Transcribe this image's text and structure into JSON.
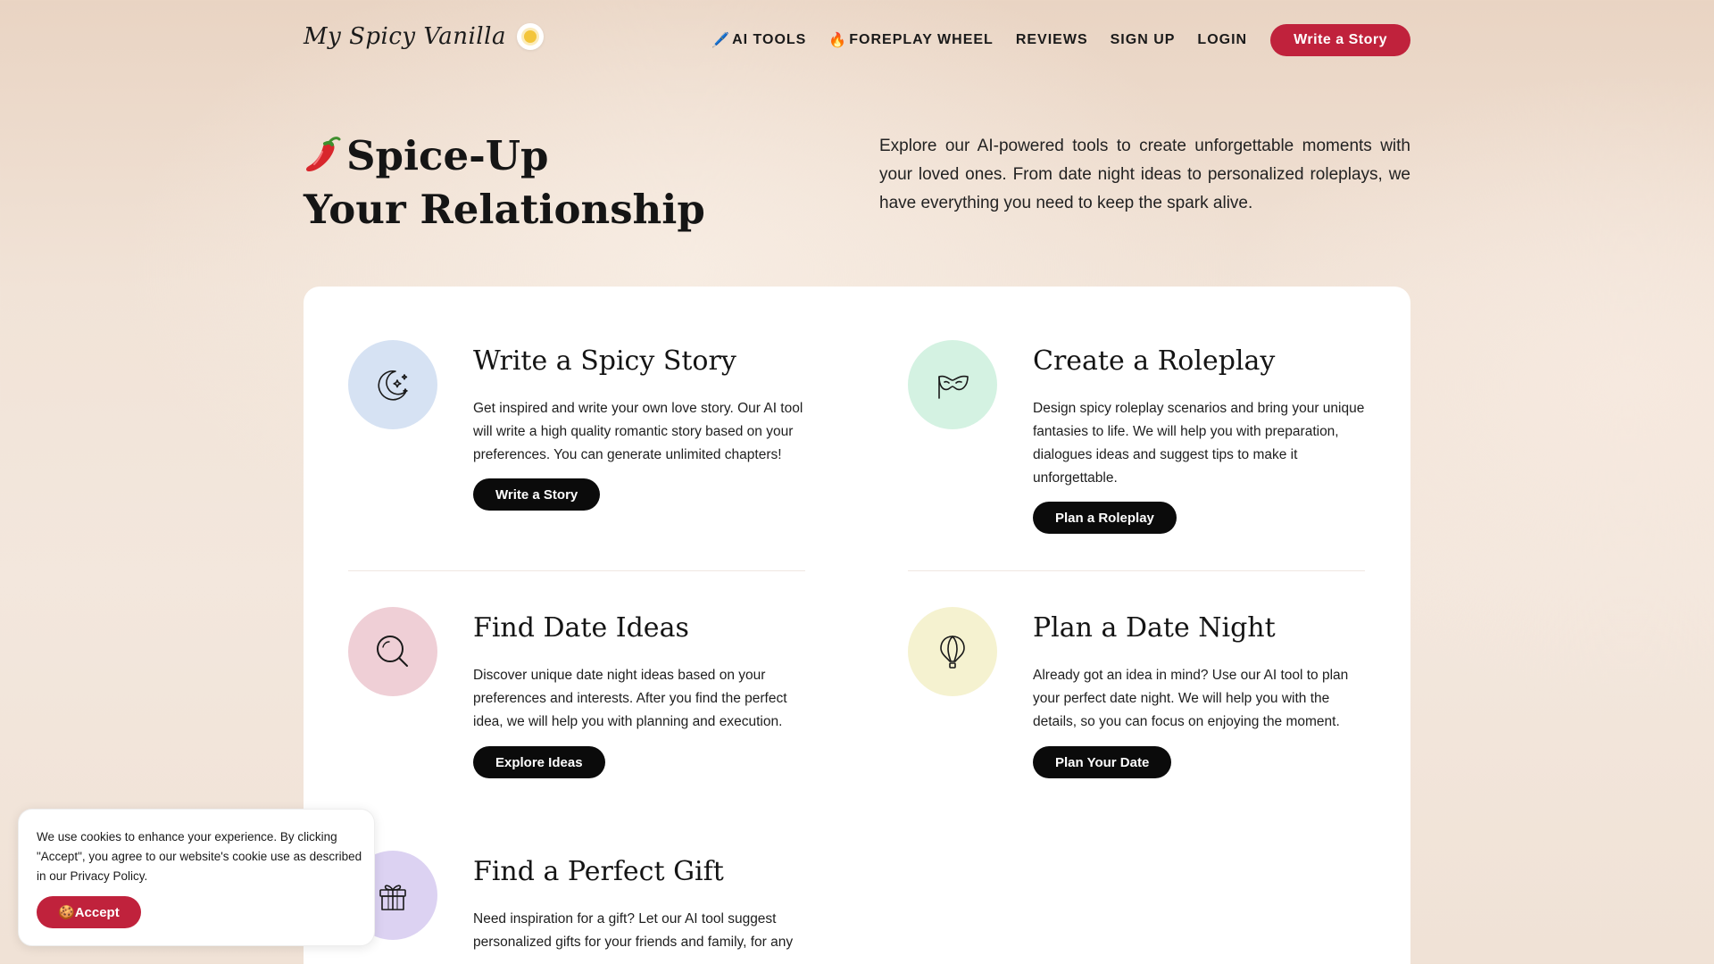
{
  "nav": {
    "logo_text": "My Spicy Vanilla",
    "links": [
      {
        "emoji": "🖊️",
        "label": "AI TOOLS"
      },
      {
        "emoji": "🔥",
        "label": "FOREPLAY WHEEL"
      },
      {
        "emoji": "",
        "label": "REVIEWS"
      },
      {
        "emoji": "",
        "label": "SIGN UP"
      },
      {
        "emoji": "",
        "label": "LOGIN"
      }
    ],
    "cta": "Write a Story"
  },
  "hero": {
    "title_line1": "Spice-Up",
    "title_line2": "Your Relationship",
    "description": "Explore our AI-powered tools to create unforgettable moments with your loved ones. From date night ideas to personalized roleplays, we have everything you need to keep the spark alive."
  },
  "features": [
    {
      "title": "Write a Spicy Story",
      "description": "Get inspired and write your own love story. Our AI tool will write a high quality romantic story based on your preferences. You can generate unlimited chapters!",
      "button": "Write a Story",
      "icon": "moon-stars-icon",
      "icon_bg": "#d6e2f3"
    },
    {
      "title": "Create a Roleplay",
      "description": "Design spicy roleplay scenarios and bring your unique fantasies to life. We will help you with preparation, dialogues ideas and suggest tips to make it unforgettable.",
      "button": "Plan a Roleplay",
      "icon": "mask-icon",
      "icon_bg": "#d4f2e2"
    },
    {
      "title": "Find Date Ideas",
      "description": "Discover unique date night ideas based on your preferences and interests. After you find the perfect idea, we will help you with planning and execution.",
      "button": "Explore Ideas",
      "icon": "search-icon",
      "icon_bg": "#efcfd6"
    },
    {
      "title": "Plan a Date Night",
      "description": "Already got an idea in mind? Use our AI tool to plan your perfect date night. We will help you with the details, so you can focus on enjoying the moment.",
      "button": "Plan Your Date",
      "icon": "hot-air-balloon-icon",
      "icon_bg": "#f5f2d0"
    },
    {
      "title": "Find a Perfect Gift",
      "description": "Need inspiration for a gift? Let our AI tool suggest personalized gifts for your friends and family, for any",
      "button": "",
      "icon": "gift-icon",
      "icon_bg": "#dcd2f2"
    }
  ],
  "cookie": {
    "text": "We use cookies to enhance your experience. By clicking \"Accept\", you agree to our website's cookie use as described in our Privacy Policy.",
    "button_emoji": "🍪",
    "button": "Accept"
  }
}
